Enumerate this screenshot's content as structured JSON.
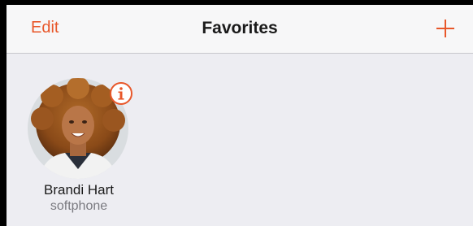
{
  "navbar": {
    "edit_label": "Edit",
    "title": "Favorites",
    "add_icon": "plus-icon"
  },
  "favorites": [
    {
      "name": "Brandi Hart",
      "subtitle": "softphone",
      "avatar": "contact-photo",
      "info_icon": "info-icon"
    }
  ],
  "colors": {
    "accent": "#e8572a",
    "background": "#ededf2",
    "navbar": "#f7f7f8"
  }
}
